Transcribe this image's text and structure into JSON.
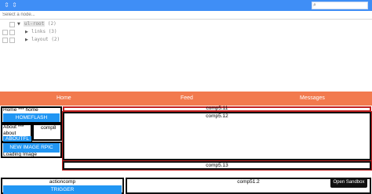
{
  "inspector": {
    "search": {
      "placeholder": ""
    },
    "select_placeholder": "Select a node...",
    "tree": {
      "root": "ul-root",
      "root_count": "(2)",
      "child_1": "links",
      "child_1_count": "(3)",
      "child_2": "layout",
      "child_2_count": "(2)"
    }
  },
  "nav": {
    "home": "Home",
    "feed": "Feed",
    "messages": "Messages"
  },
  "home": {
    "header": "Home *** home",
    "flash_button": "HOMEFLASH",
    "about_label": "About *** about",
    "about_button": "ABOUTFL",
    "comp8": "comp8",
    "image_button": "NEW IMAGE RPIC",
    "loading": "Loading Image"
  },
  "comps": {
    "c11": "comp5.11",
    "c12": "comp5.12",
    "c13": "comp5.13",
    "c512": "comp51.2"
  },
  "action": {
    "label": "actioncomp",
    "button": "TRIGGER"
  },
  "sandbox_button": "Open Sandbox",
  "colors": {
    "inspector": "#3f8ef6",
    "nav": "#f27a4e",
    "button": "#2196f3",
    "red_border": "#c21d1d"
  }
}
